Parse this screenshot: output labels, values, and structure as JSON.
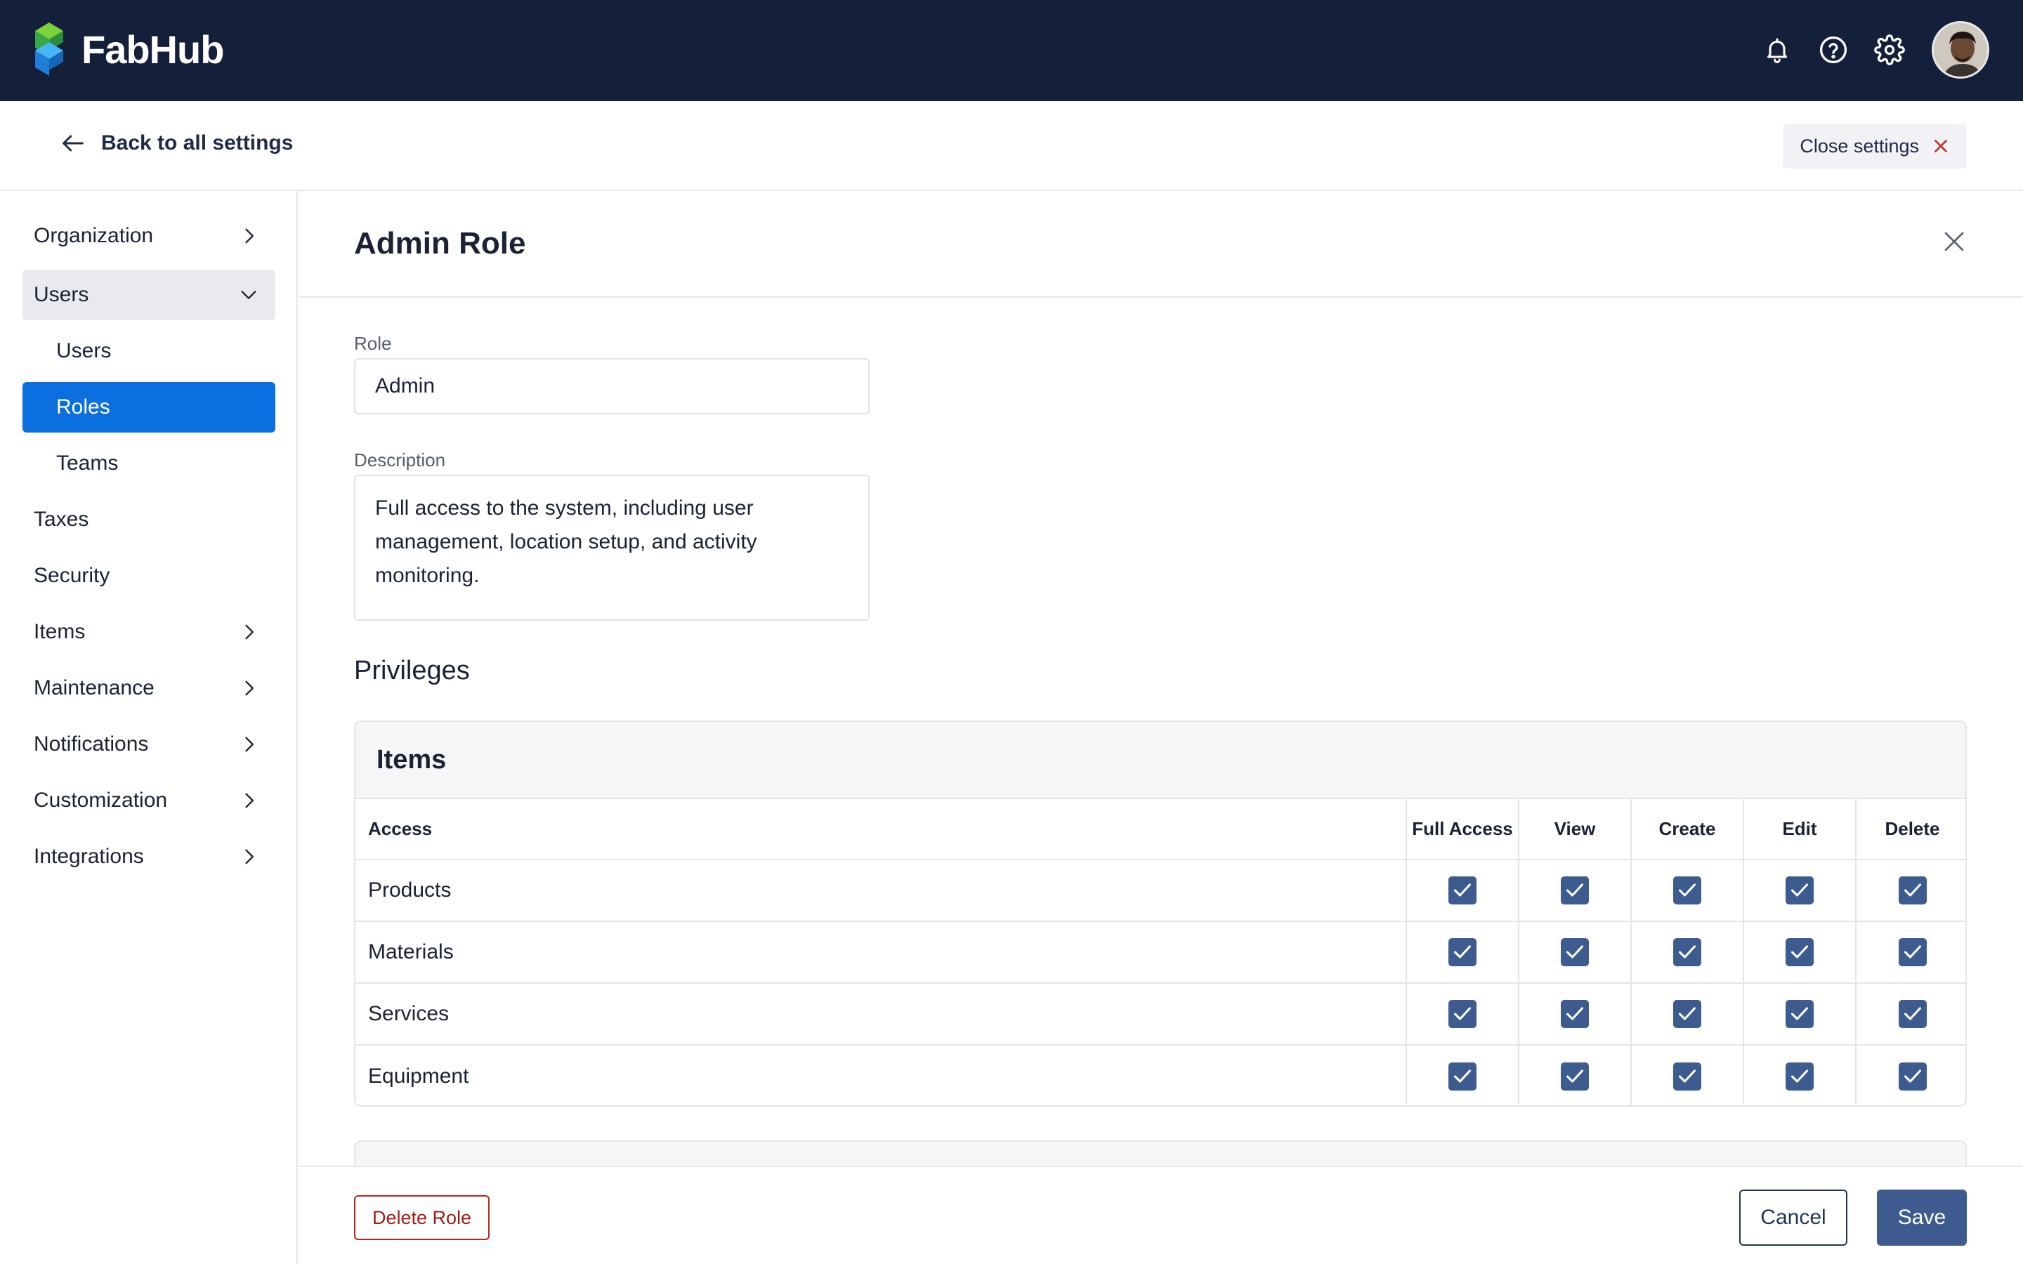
{
  "app": {
    "name": "FabHub"
  },
  "topbar": {
    "icons": [
      "bell-icon",
      "help-icon",
      "gear-icon"
    ],
    "avatar": "user-avatar"
  },
  "subheader": {
    "back_label": "Back to all settings",
    "close_label": "Close settings"
  },
  "sidebar": {
    "items": [
      {
        "label": "Organization",
        "has_children": true,
        "state": "collapsed"
      },
      {
        "label": "Users",
        "has_children": true,
        "state": "expanded"
      },
      {
        "label": "Users",
        "sub": true
      },
      {
        "label": "Roles",
        "sub": true,
        "active": true
      },
      {
        "label": "Teams",
        "sub": true
      },
      {
        "label": "Taxes"
      },
      {
        "label": "Security"
      },
      {
        "label": "Items",
        "has_children": true,
        "state": "collapsed"
      },
      {
        "label": "Maintenance",
        "has_children": true,
        "state": "collapsed"
      },
      {
        "label": "Notifications",
        "has_children": true,
        "state": "collapsed"
      },
      {
        "label": "Customization",
        "has_children": true,
        "state": "collapsed"
      },
      {
        "label": "Integrations",
        "has_children": true,
        "state": "collapsed"
      }
    ]
  },
  "panel": {
    "title": "Admin Role",
    "role_label": "Role",
    "role_value": "Admin",
    "description_label": "Description",
    "description_value": "Full access to the system, including user management, location setup, and activity monitoring.",
    "privileges_title": "Privileges"
  },
  "privileges": {
    "group_title": "Items",
    "columns": [
      "Access",
      "Full Access",
      "View",
      "Create",
      "Edit",
      "Delete"
    ],
    "rows": [
      {
        "name": "Products",
        "checks": [
          true,
          true,
          true,
          true,
          true
        ]
      },
      {
        "name": "Materials",
        "checks": [
          true,
          true,
          true,
          true,
          true
        ]
      },
      {
        "name": "Services",
        "checks": [
          true,
          true,
          true,
          true,
          true
        ]
      },
      {
        "name": "Equipment",
        "checks": [
          true,
          true,
          true,
          true,
          true
        ]
      }
    ]
  },
  "footer": {
    "delete_label": "Delete Role",
    "cancel_label": "Cancel",
    "save_label": "Save"
  },
  "colors": {
    "topbar": "#141f3a",
    "active_nav": "#0c6fe0",
    "primary": "#3d5b8e",
    "danger": "#b3261e"
  }
}
